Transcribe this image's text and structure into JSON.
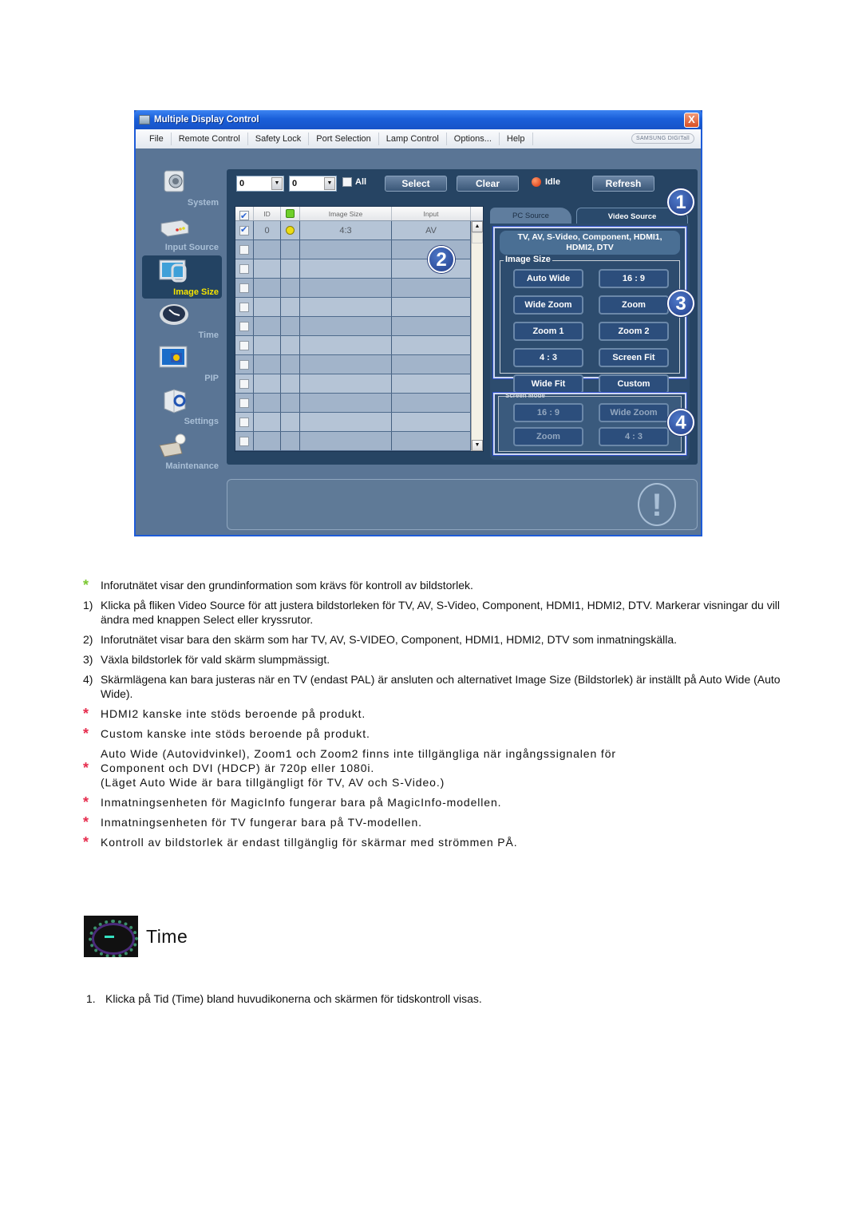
{
  "window": {
    "title": "Multiple Display Control",
    "close_glyph": "X",
    "menu": [
      "File",
      "Remote Control",
      "Safety Lock",
      "Port Selection",
      "Lamp Control",
      "Options...",
      "Help"
    ],
    "brand": "SAMSUNG DIGITall"
  },
  "sidebar": {
    "items": [
      {
        "label": "System",
        "icon": "system-icon",
        "active": false
      },
      {
        "label": "Input Source",
        "icon": "input-source-icon",
        "active": false
      },
      {
        "label": "Image Size",
        "icon": "image-size-icon",
        "active": true
      },
      {
        "label": "Time",
        "icon": "clock-icon",
        "active": false
      },
      {
        "label": "PIP",
        "icon": "pip-icon",
        "active": false
      },
      {
        "label": "Settings",
        "icon": "settings-icon",
        "active": false
      },
      {
        "label": "Maintenance",
        "icon": "maintenance-icon",
        "active": false
      }
    ]
  },
  "toolbar": {
    "combo1_value": "0",
    "combo2_value": "0",
    "all_label": "All",
    "all_checked": false,
    "select_label": "Select",
    "clear_label": "Clear",
    "status_text": "Idle",
    "status_color": "#d8300b",
    "refresh_label": "Refresh"
  },
  "grid": {
    "columns": [
      "",
      "ID",
      "",
      "Image Size",
      "Input"
    ],
    "rows": [
      {
        "checked": true,
        "id": "0",
        "power": true,
        "image_size": "4:3",
        "input": "AV"
      },
      {
        "checked": false,
        "id": "",
        "power": false,
        "image_size": "",
        "input": ""
      },
      {
        "checked": false,
        "id": "",
        "power": false,
        "image_size": "",
        "input": ""
      },
      {
        "checked": false,
        "id": "",
        "power": false,
        "image_size": "",
        "input": ""
      },
      {
        "checked": false,
        "id": "",
        "power": false,
        "image_size": "",
        "input": ""
      },
      {
        "checked": false,
        "id": "",
        "power": false,
        "image_size": "",
        "input": ""
      },
      {
        "checked": false,
        "id": "",
        "power": false,
        "image_size": "",
        "input": ""
      },
      {
        "checked": false,
        "id": "",
        "power": false,
        "image_size": "",
        "input": ""
      },
      {
        "checked": false,
        "id": "",
        "power": false,
        "image_size": "",
        "input": ""
      },
      {
        "checked": false,
        "id": "",
        "power": false,
        "image_size": "",
        "input": ""
      },
      {
        "checked": false,
        "id": "",
        "power": false,
        "image_size": "",
        "input": ""
      },
      {
        "checked": false,
        "id": "",
        "power": false,
        "image_size": "",
        "input": ""
      }
    ]
  },
  "tabs": {
    "pc_source": "PC Source",
    "video_source": "Video Source",
    "active": "video_source"
  },
  "video_panel": {
    "sources_line1": "TV, AV, S-Video, Component, HDMI1,",
    "sources_line2": "HDMI2, DTV",
    "image_size_legend": "Image Size",
    "image_size_buttons": [
      "Auto Wide",
      "16 : 9",
      "Wide Zoom",
      "Zoom",
      "Zoom 1",
      "Zoom 2",
      "4 : 3",
      "Screen Fit",
      "Wide Fit",
      "Custom"
    ],
    "screen_mode_legend": "Screen Mode",
    "screen_mode_buttons": [
      "16 : 9",
      "Wide Zoom",
      "Zoom",
      "4 : 3"
    ]
  },
  "callouts": [
    "1",
    "2",
    "3",
    "4"
  ],
  "message_panel": {
    "icon_glyph": "!"
  },
  "doc": {
    "notes": [
      {
        "marker": "*",
        "marker_type": "green",
        "text": "Inforutnätet visar den grundinformation som krävs för kontroll av bildstorlek."
      },
      {
        "marker": "1)",
        "marker_type": "num",
        "text": "Klicka på fliken Video Source för att justera bildstorleken för TV, AV, S-Video, Component, HDMI1, HDMI2, DTV. Markerar visningar du vill ändra med knappen Select eller kryssrutor."
      },
      {
        "marker": "2)",
        "marker_type": "num",
        "text": "Inforutnätet visar bara den skärm som har TV, AV, S-VIDEO, Component, HDMI1, HDMI2, DTV som inmatningskälla."
      },
      {
        "marker": "3)",
        "marker_type": "num",
        "text": "Växla bildstorlek för vald skärm slumpmässigt."
      },
      {
        "marker": "4)",
        "marker_type": "num",
        "text": "Skärmlägena kan bara justeras när en TV (endast PAL) är ansluten och alternativet Image Size (Bildstorlek) är inställt på Auto Wide (Auto Wide)."
      },
      {
        "marker": "*",
        "marker_type": "red",
        "text": "HDMI2 kanske inte stöds beroende på produkt."
      },
      {
        "marker": "*",
        "marker_type": "red",
        "text": "Custom kanske inte stöds beroende på produkt."
      },
      {
        "marker": "*",
        "marker_type": "red",
        "text": "Auto Wide (Autovidvinkel), Zoom1 och Zoom2 finns inte tillgängliga när ingångssignalen för Component och DVI (HDCP) är 720p eller 1080i. (Läget Auto Wide är bara tillgängligt för TV, AV och S-Video.)",
        "lines": [
          "Auto Wide (Autovidvinkel), Zoom1 och Zoom2 finns inte tillgängliga när ingångssignalen för",
          "Component och DVI (HDCP) är 720p eller 1080i.",
          "(Läget Auto Wide är bara tillgängligt för TV, AV och S-Video.)"
        ]
      },
      {
        "marker": "*",
        "marker_type": "red",
        "text": "Inmatningsenheten för MagicInfo fungerar bara på MagicInfo-modellen."
      },
      {
        "marker": "*",
        "marker_type": "red",
        "text": "Inmatningsenheten för TV fungerar bara på TV-modellen."
      },
      {
        "marker": "*",
        "marker_type": "red",
        "text": "Kontroll av bildstorlek är endast tillgänglig för skärmar med strömmen PÅ."
      }
    ],
    "section_title": "Time",
    "steps": [
      {
        "number": "1.",
        "text": "Klicka på Tid (Time) bland huvudikonerna och skärmen för tidskontroll visas."
      }
    ]
  }
}
